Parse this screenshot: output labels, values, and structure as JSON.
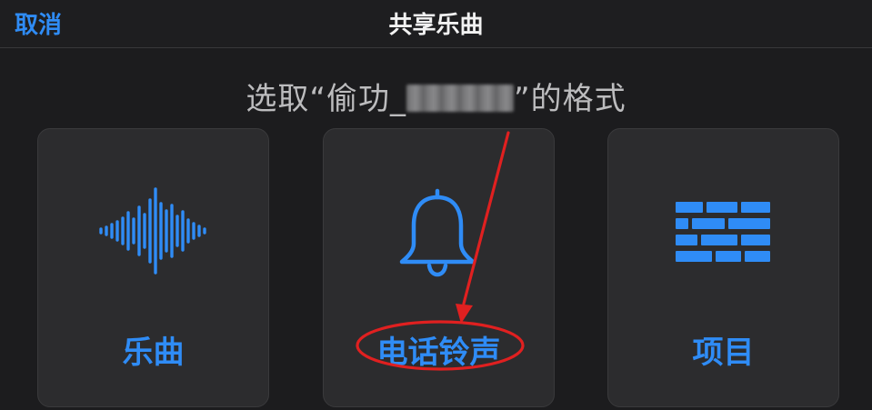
{
  "nav": {
    "cancel_label": "取消",
    "title": "共享乐曲"
  },
  "prompt": {
    "prefix": "选取“偷功_",
    "suffix": "”的格式"
  },
  "options": [
    {
      "label": "乐曲",
      "icon": "waveform-icon"
    },
    {
      "label": "电话铃声",
      "icon": "bell-icon"
    },
    {
      "label": "项目",
      "icon": "brick-grid-icon"
    }
  ],
  "colors": {
    "accent": "#2f8cf6",
    "background": "#1c1c1e",
    "card": "#2c2c2e",
    "annotation": "#e02020"
  }
}
